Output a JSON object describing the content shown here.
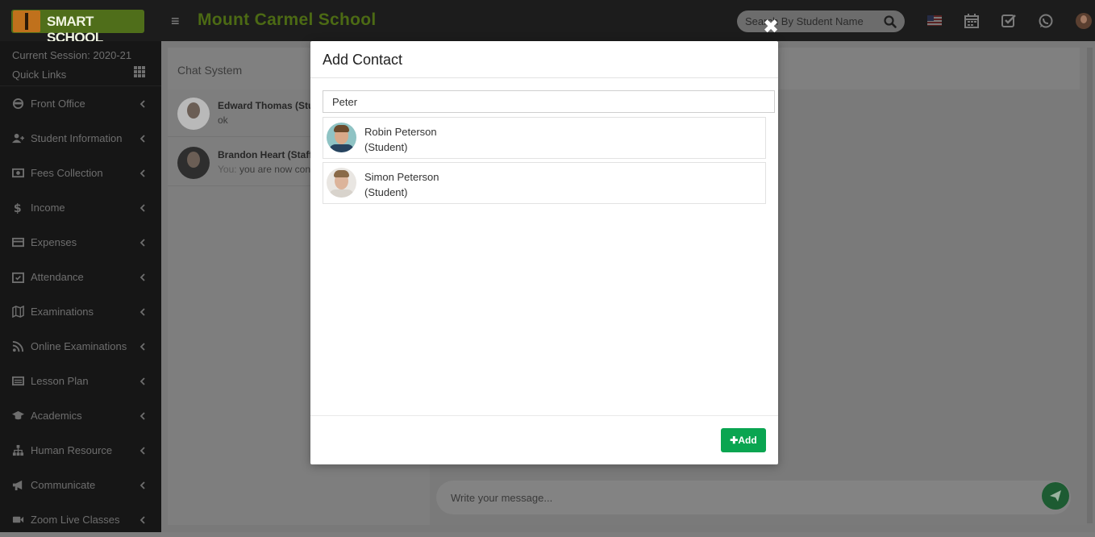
{
  "header": {
    "logo_text": "SMART SCHOOL",
    "school_name": "Mount Carmel School",
    "search_placeholder": "Search By Student Name"
  },
  "sidebar": {
    "session": "Current Session: 2020-21",
    "quick_links": "Quick Links",
    "items": [
      {
        "label": "Front Office",
        "icon": "front-office-icon"
      },
      {
        "label": "Student Information",
        "icon": "user-plus-icon"
      },
      {
        "label": "Fees Collection",
        "icon": "money-icon"
      },
      {
        "label": "Income",
        "icon": "dollar-icon"
      },
      {
        "label": "Expenses",
        "icon": "credit-card-icon"
      },
      {
        "label": "Attendance",
        "icon": "calendar-check-icon"
      },
      {
        "label": "Examinations",
        "icon": "map-icon"
      },
      {
        "label": "Online Examinations",
        "icon": "rss-icon"
      },
      {
        "label": "Lesson Plan",
        "icon": "list-icon"
      },
      {
        "label": "Academics",
        "icon": "graduation-cap-icon"
      },
      {
        "label": "Human Resource",
        "icon": "sitemap-icon"
      },
      {
        "label": "Communicate",
        "icon": "bullhorn-icon"
      },
      {
        "label": "Zoom Live Classes",
        "icon": "video-icon"
      }
    ]
  },
  "chat": {
    "title": "Chat System",
    "contacts": [
      {
        "name": "Edward Thomas (Student)",
        "prefix": "",
        "message": "ok"
      },
      {
        "name": "Brandon Heart (Staff)",
        "prefix": "You:",
        "message": "you are now connected"
      }
    ],
    "message_placeholder": "Write your message..."
  },
  "modal": {
    "title": "Add Contact",
    "search_value": "Peter",
    "results": [
      {
        "name": "Robin Peterson",
        "role": "(Student)"
      },
      {
        "name": "Simon Peterson",
        "role": "(Student)"
      }
    ],
    "add_label": "Add"
  }
}
